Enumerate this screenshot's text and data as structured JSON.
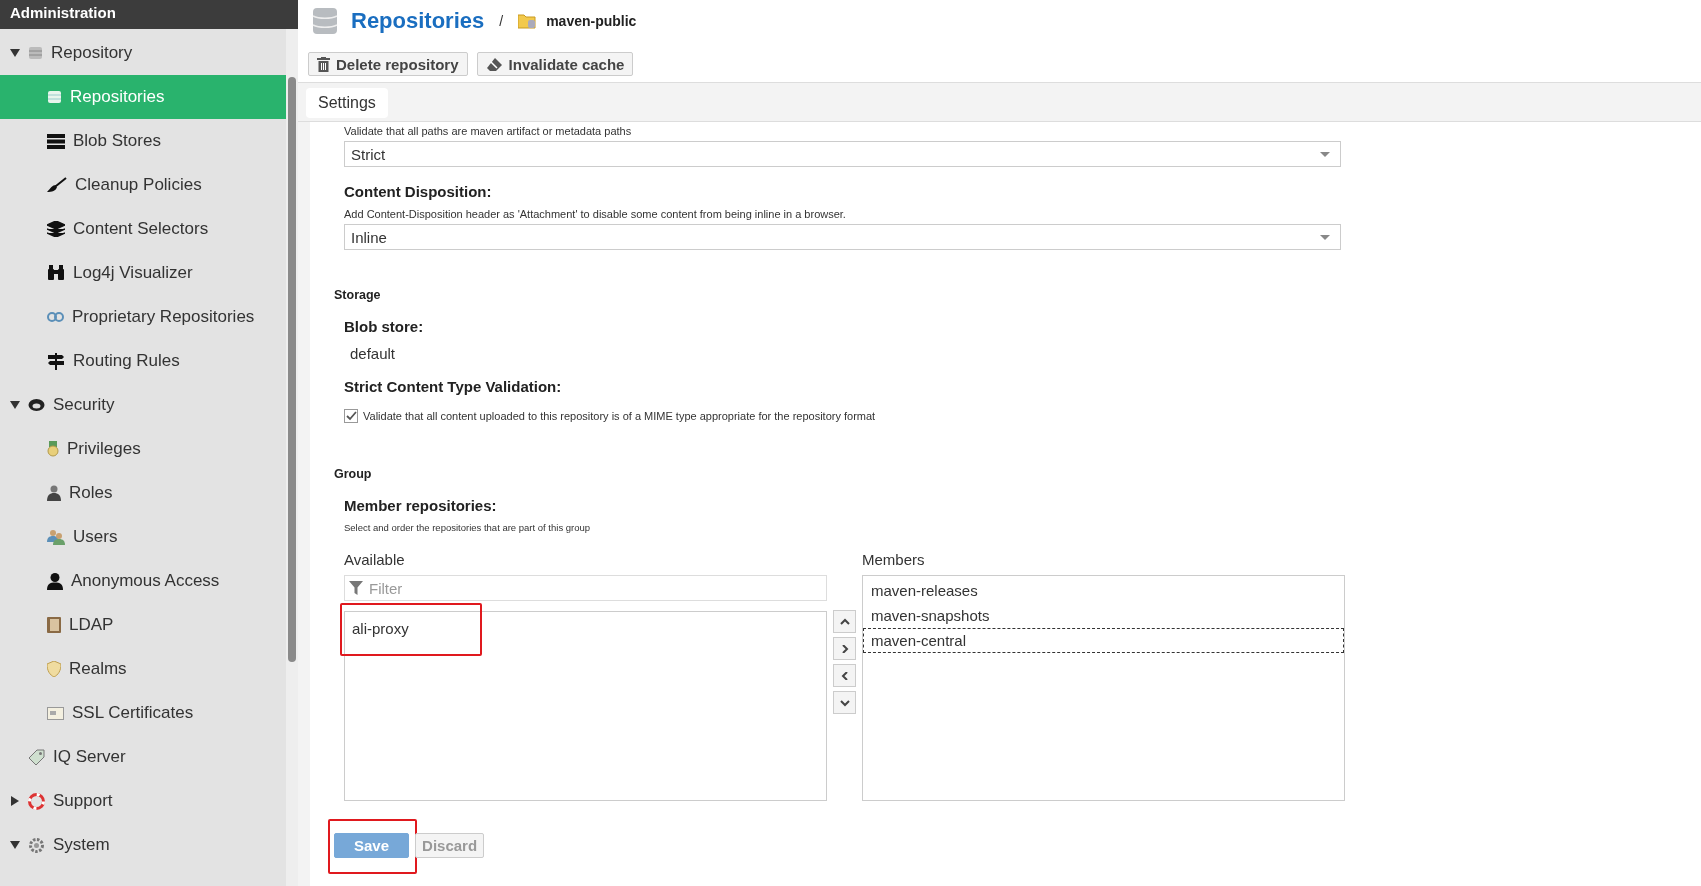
{
  "sidebar": {
    "title": "Administration",
    "items": [
      {
        "label": "Repository",
        "expanded": true,
        "selected": false,
        "children": [
          {
            "label": "Repositories",
            "selected": true
          },
          {
            "label": "Blob Stores",
            "selected": false
          },
          {
            "label": "Cleanup Policies",
            "selected": false
          },
          {
            "label": "Content Selectors",
            "selected": false
          },
          {
            "label": "Log4j Visualizer",
            "selected": false
          },
          {
            "label": "Proprietary Repositories",
            "selected": false
          },
          {
            "label": "Routing Rules",
            "selected": false
          }
        ]
      },
      {
        "label": "Security",
        "expanded": true,
        "selected": false,
        "children": [
          {
            "label": "Privileges",
            "selected": false
          },
          {
            "label": "Roles",
            "selected": false
          },
          {
            "label": "Users",
            "selected": false
          },
          {
            "label": "Anonymous Access",
            "selected": false
          },
          {
            "label": "LDAP",
            "selected": false
          },
          {
            "label": "Realms",
            "selected": false
          },
          {
            "label": "SSL Certificates",
            "selected": false
          }
        ]
      },
      {
        "label": "IQ Server",
        "selected": false
      },
      {
        "label": "Support",
        "expanded": false,
        "selected": false
      },
      {
        "label": "System",
        "expanded": true,
        "selected": false
      }
    ]
  },
  "header": {
    "title": "Repositories",
    "separator": "/",
    "current": "maven-public"
  },
  "toolbar": [
    "Delete repository",
    "Invalidate cache"
  ],
  "tabs": [
    {
      "label": "Settings",
      "selected": true
    }
  ],
  "selects": [
    {
      "hint": "Validate that all paths are maven artifact or metadata paths",
      "value": "Strict"
    },
    {
      "label": "Content Disposition:",
      "hint": "Add Content-Disposition header as 'Attachment' to disable some content from being inline in a browser.",
      "value": "Inline"
    }
  ],
  "storage": {
    "heading": "Storage",
    "blob_label": "Blob store:",
    "blob_value": "default",
    "strict_label": "Strict Content Type Validation:",
    "strict_checkbox": {
      "label": "Validate that all content uploaded to this repository is of a MIME type appropriate for the repository format",
      "checked": true
    }
  },
  "group": {
    "heading": "Group",
    "label": "Member repositories:",
    "hint": "Select and order the repositories that are part of this group",
    "available_label": "Available",
    "filter_placeholder": "Filter",
    "available": [
      {
        "name": "ali-proxy",
        "highlighted": true
      }
    ],
    "members_label": "Members",
    "members": [
      {
        "name": "maven-releases",
        "focused": false
      },
      {
        "name": "maven-snapshots",
        "focused": false
      },
      {
        "name": "maven-central",
        "focused": true
      }
    ]
  },
  "buttons": [
    {
      "label": "Save",
      "kind": "primary",
      "disabled": true,
      "highlighted": true
    },
    {
      "label": "Discard",
      "kind": "secondary",
      "disabled": true,
      "highlighted": false
    }
  ]
}
